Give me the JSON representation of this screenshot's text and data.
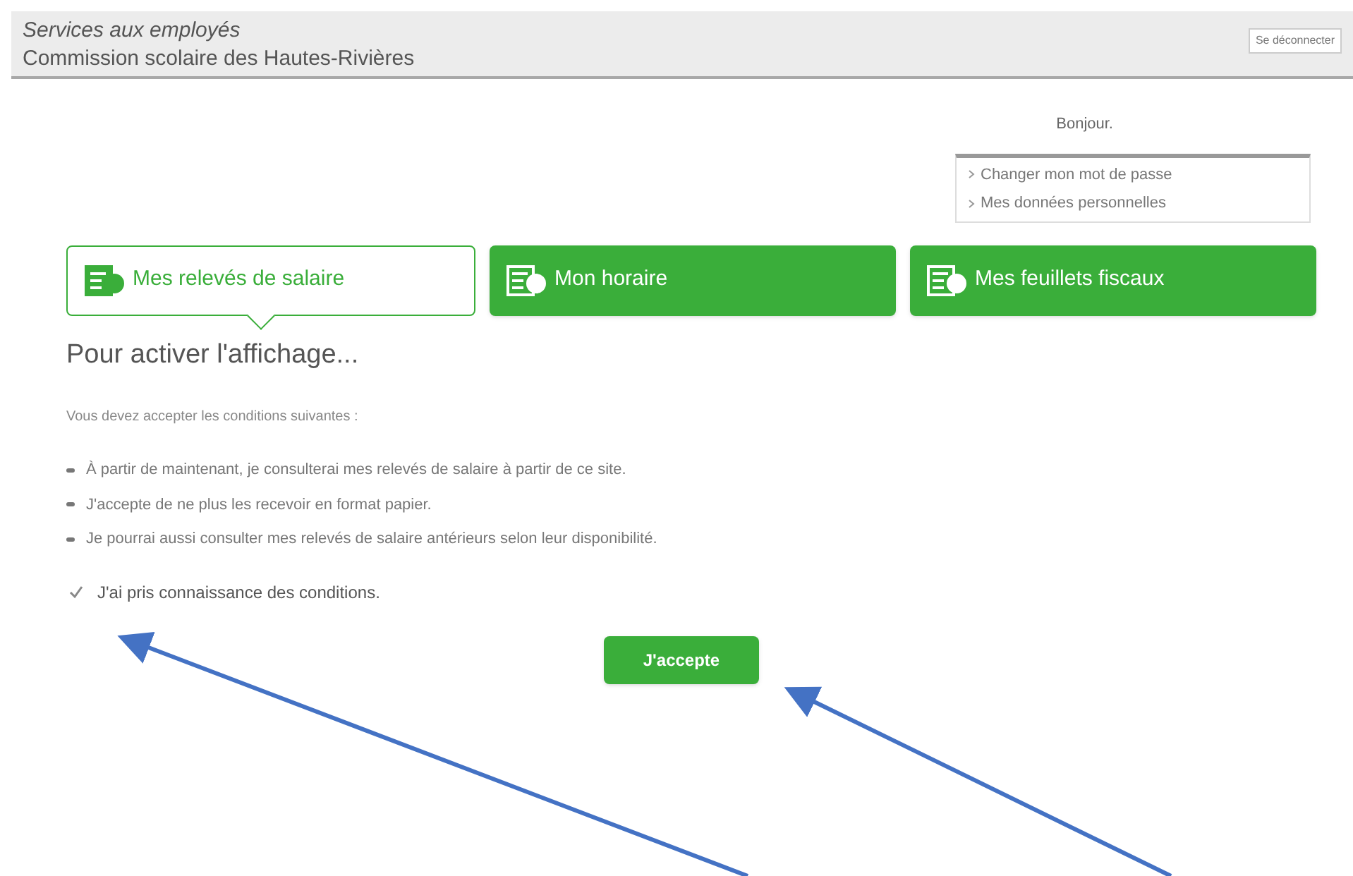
{
  "header": {
    "subtitle": "Services aux employés",
    "title": "Commission scolaire des Hautes-Rivières",
    "logout": "Se déconnecter"
  },
  "greeting": "Bonjour.",
  "user_menu": [
    "Changer mon mot de passe",
    "Mes données personnelles"
  ],
  "tabs": [
    {
      "label": "Mes relevés de salaire",
      "selected": true
    },
    {
      "label": "Mon horaire",
      "selected": false
    },
    {
      "label": "Mes feuillets fiscaux",
      "selected": false
    }
  ],
  "heading": "Pour activer l'affichage...",
  "intro": "Vous devez accepter les conditions suivantes :",
  "conditions": [
    "À partir de maintenant, je consulterai mes relevés de salaire à partir de ce site.",
    "J'accepte de ne plus les recevoir en format papier.",
    "Je pourrai aussi consulter mes relevés de salaire antérieurs selon leur disponibilité."
  ],
  "agreement": {
    "label": "J'ai pris connaissance des conditions.",
    "checked": true
  },
  "accept_button": "J'accepte"
}
